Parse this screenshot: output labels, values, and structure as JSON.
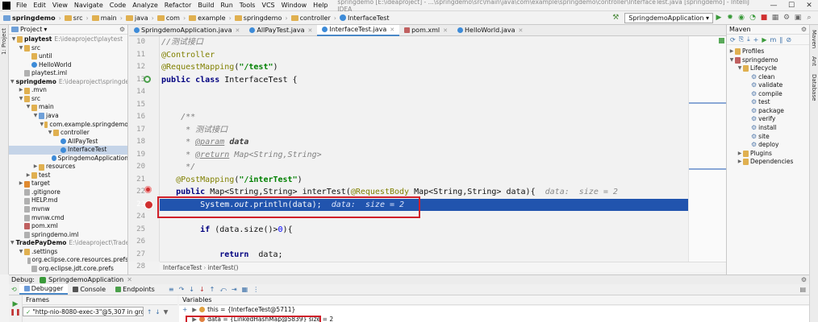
{
  "menubar": {
    "items": [
      "File",
      "Edit",
      "View",
      "Navigate",
      "Code",
      "Analyze",
      "Refactor",
      "Build",
      "Run",
      "Tools",
      "VCS",
      "Window",
      "Help"
    ],
    "title": "springdemo [E:\\ideaproject] - ...\\springdemo\\src\\main\\java\\com\\example\\springdemo\\controller\\InterfaceTest.java [springdemo] - IntelliJ IDEA"
  },
  "navbar": {
    "crumbs": [
      "springdemo",
      "src",
      "main",
      "java",
      "com",
      "example",
      "springdemo",
      "controller",
      "InterfaceTest"
    ],
    "run_config": "SpringdemoApplication"
  },
  "project": {
    "header": "Project",
    "tree": [
      {
        "label": "playtest",
        "path": "E:\\ideaproject\\playtest",
        "indent": 0,
        "arrow": "▼",
        "bold": true,
        "icon": "folder"
      },
      {
        "label": "src",
        "indent": 1,
        "arrow": "▼",
        "icon": "folder"
      },
      {
        "label": "until",
        "indent": 2,
        "arrow": "",
        "icon": "folder"
      },
      {
        "label": "HelloWorld",
        "indent": 2,
        "arrow": "",
        "icon": "class"
      },
      {
        "label": "playtest.iml",
        "indent": 1,
        "arrow": "",
        "icon": "file"
      },
      {
        "label": "springdemo",
        "path": "E:\\ideaproject\\springdemo",
        "indent": 0,
        "arrow": "▼",
        "bold": true,
        "icon": "folder"
      },
      {
        "label": ".mvn",
        "indent": 1,
        "arrow": "▶",
        "icon": "folder"
      },
      {
        "label": "src",
        "indent": 1,
        "arrow": "▼",
        "icon": "folder"
      },
      {
        "label": "main",
        "indent": 2,
        "arrow": "▼",
        "icon": "folder"
      },
      {
        "label": "java",
        "indent": 3,
        "arrow": "▼",
        "icon": "folder-blue"
      },
      {
        "label": "com.example.springdemo",
        "indent": 4,
        "arrow": "▼",
        "icon": "folder"
      },
      {
        "label": "controller",
        "indent": 5,
        "arrow": "▼",
        "icon": "folder"
      },
      {
        "label": "AllPayTest",
        "indent": 6,
        "arrow": "",
        "icon": "class"
      },
      {
        "label": "InterfaceTest",
        "indent": 6,
        "arrow": "",
        "icon": "class",
        "selected": true
      },
      {
        "label": "SpringdemoApplication",
        "indent": 5,
        "arrow": "",
        "icon": "class"
      },
      {
        "label": "resources",
        "indent": 3,
        "arrow": "▶",
        "icon": "folder"
      },
      {
        "label": "test",
        "indent": 2,
        "arrow": "▶",
        "icon": "folder"
      },
      {
        "label": "target",
        "indent": 1,
        "arrow": "▶",
        "icon": "folder-orange"
      },
      {
        "label": ".gitignore",
        "indent": 1,
        "arrow": "",
        "icon": "file"
      },
      {
        "label": "HELP.md",
        "indent": 1,
        "arrow": "",
        "icon": "file"
      },
      {
        "label": "mvnw",
        "indent": 1,
        "arrow": "",
        "icon": "file"
      },
      {
        "label": "mvnw.cmd",
        "indent": 1,
        "arrow": "",
        "icon": "file"
      },
      {
        "label": "pom.xml",
        "indent": 1,
        "arrow": "",
        "icon": "maven"
      },
      {
        "label": "springdemo.iml",
        "indent": 1,
        "arrow": "",
        "icon": "file"
      },
      {
        "label": "TradePayDemo",
        "path": "E:\\ideaproject\\TradePayD",
        "indent": 0,
        "arrow": "▼",
        "bold": true,
        "icon": "folder"
      },
      {
        "label": ".settings",
        "indent": 1,
        "arrow": "▼",
        "icon": "folder"
      },
      {
        "label": "org.eclipse.core.resources.prefs",
        "indent": 2,
        "arrow": "",
        "icon": "file"
      },
      {
        "label": "org.eclipse.jdt.core.prefs",
        "indent": 2,
        "arrow": "",
        "icon": "file"
      }
    ]
  },
  "tabs": [
    "SpringdemoApplication.java",
    "AllPayTest.java",
    "InterfaceTest.java",
    "pom.xml",
    "HelloWorld.java"
  ],
  "active_tab": 2,
  "editor": {
    "line_numbers": [
      "10",
      "11",
      "12",
      "13",
      "14",
      "15",
      "16",
      "17",
      "18",
      "19",
      "20",
      "21",
      "22",
      "23",
      "24",
      "25",
      "26",
      "27"
    ],
    "lines": [
      {
        "n": "10",
        "html": "<span class='cm'>//测试接口</span>"
      },
      {
        "n": "11",
        "html": "<span class='an'>@Controller</span>"
      },
      {
        "n": "12",
        "html": "<span class='an'>@RequestMapping</span>(<span class='st'>\"/test\"</span>)"
      },
      {
        "n": "13",
        "html": "<span class='kw'>public class</span> InterfaceTest {"
      },
      {
        "n": "14",
        "html": ""
      },
      {
        "n": "15",
        "html": ""
      },
      {
        "n": "16",
        "html": "    <span class='cm'>/**</span>"
      },
      {
        "n": "17",
        "html": "    <span class='cm'> * 测试接口</span>"
      },
      {
        "n": "18",
        "html": "    <span class='cm'> * <u>@param</u> </span><b class='cm' style='color:#3d3d3d'>data</b>"
      },
      {
        "n": "19",
        "html": "    <span class='cm'> * <u>@return</u> Map&lt;String,String&gt;</span>"
      },
      {
        "n": "20",
        "html": "    <span class='cm'> */</span>"
      },
      {
        "n": "21",
        "html": "   <span class='an'>@PostMapping</span>(<span class='st'>\"/interTest\"</span>)"
      },
      {
        "n": "22",
        "html": "   <span class='kw'>public</span> Map&lt;String,String&gt; interTest(<span class='an'>@RequestBody</span> Map&lt;String,String&gt; data){  <span class='inl'>data:  size = 2</span>"
      },
      {
        "n": "23",
        "html": "        <span style='color:#fff'>System.<span class='it'>out</span>.println(data);  <span class='it' style='color:#dfe8ff'>data:  size = 2</span></span>"
      },
      {
        "n": "24",
        "html": ""
      },
      {
        "n": "25",
        "html": "        <span class='kw'>if</span> (data.size()&gt;<span style='color:#0000ff'>0</span>){"
      },
      {
        "n": "26",
        "html": ""
      },
      {
        "n": "27",
        "html": "            <span class='kw'>return</span>  data;"
      },
      {
        "n": "28",
        "html": "        }"
      }
    ]
  },
  "editor_breadcrumb": [
    "InterfaceTest",
    "interTest()"
  ],
  "maven": {
    "header": "Maven",
    "items": [
      {
        "label": "Profiles",
        "indent": 0,
        "arrow": "▶",
        "icon": "folder"
      },
      {
        "label": "springdemo",
        "indent": 0,
        "arrow": "▼",
        "icon": "maven"
      },
      {
        "label": "Lifecycle",
        "indent": 1,
        "arrow": "▼",
        "icon": "folder"
      },
      {
        "label": "clean",
        "indent": 2,
        "arrow": "",
        "icon": "gear"
      },
      {
        "label": "validate",
        "indent": 2,
        "arrow": "",
        "icon": "gear"
      },
      {
        "label": "compile",
        "indent": 2,
        "arrow": "",
        "icon": "gear"
      },
      {
        "label": "test",
        "indent": 2,
        "arrow": "",
        "icon": "gear"
      },
      {
        "label": "package",
        "indent": 2,
        "arrow": "",
        "icon": "gear"
      },
      {
        "label": "verify",
        "indent": 2,
        "arrow": "",
        "icon": "gear"
      },
      {
        "label": "install",
        "indent": 2,
        "arrow": "",
        "icon": "gear"
      },
      {
        "label": "site",
        "indent": 2,
        "arrow": "",
        "icon": "gear"
      },
      {
        "label": "deploy",
        "indent": 2,
        "arrow": "",
        "icon": "gear"
      },
      {
        "label": "Plugins",
        "indent": 1,
        "arrow": "▶",
        "icon": "folder"
      },
      {
        "label": "Dependencies",
        "indent": 1,
        "arrow": "▶",
        "icon": "folder"
      }
    ]
  },
  "left_strip": [
    "1: Project"
  ],
  "right_strip": [
    "Maven",
    "Ant",
    "Database"
  ],
  "debug": {
    "label": "Debug:",
    "config": "SpringdemoApplication",
    "tabs": [
      "Debugger",
      "Console",
      "Endpoints"
    ],
    "frames_header": "Frames",
    "variables_header": "Variables",
    "thread": "\"http-nio-8080-exec-3\"@5,307 in group...",
    "vars": [
      {
        "text": "this = {InterfaceTest@5711}"
      },
      {
        "text": "data = {LinkedHashMap@5839}  size = 2"
      }
    ]
  },
  "colors": {
    "exec_line": "#2154ae",
    "highlight_box": "#d0202a",
    "selection": "#c5d4e8"
  }
}
